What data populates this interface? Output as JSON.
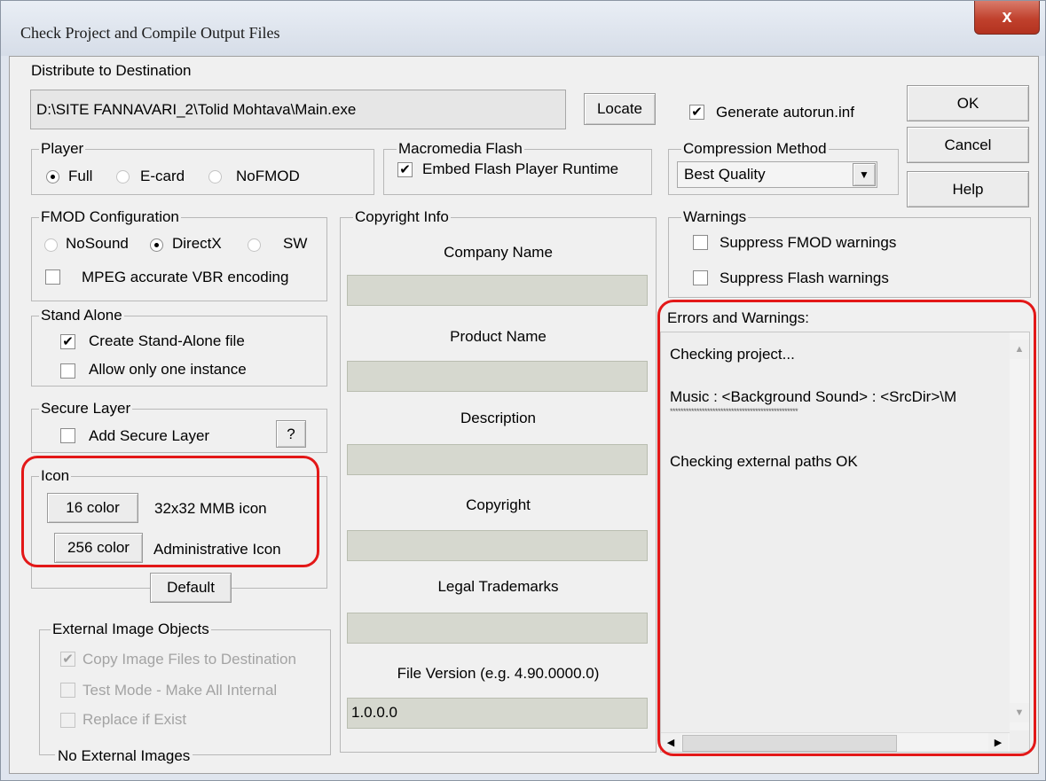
{
  "window": {
    "title": "Check Project and Compile Output Files",
    "close_label": "x"
  },
  "destination": {
    "label": "Distribute to Destination",
    "path": "D:\\SITE FANNAVARI_2\\Tolid Mohtava\\Main.exe",
    "locate_label": "Locate",
    "autorun_label": "Generate autorun.inf",
    "autorun_checked": true
  },
  "actions": {
    "ok": "OK",
    "cancel": "Cancel",
    "help": "Help"
  },
  "player": {
    "title": "Player",
    "options": [
      "Full",
      "E-card",
      "NoFMOD"
    ],
    "selected": "Full"
  },
  "flash": {
    "title": "Macromedia Flash",
    "embed_label": "Embed Flash Player Runtime",
    "embed_checked": true
  },
  "compression": {
    "title": "Compression Method",
    "selected": "Best Quality"
  },
  "fmod": {
    "title": "FMOD Configuration",
    "options": [
      "NoSound",
      "DirectX",
      "SW"
    ],
    "selected": "DirectX",
    "mpeg_label": "MPEG accurate VBR encoding",
    "mpeg_checked": false
  },
  "copyright": {
    "title": "Copyright Info",
    "company_label": "Company Name",
    "company_value": "",
    "product_label": "Product Name",
    "product_value": "",
    "description_label": "Description",
    "description_value": "",
    "copyright_label": "Copyright",
    "copyright_value": "",
    "trademarks_label": "Legal Trademarks",
    "trademarks_value": "",
    "version_label": "File Version (e.g. 4.90.0000.0)",
    "version_value": "1.0.0.0"
  },
  "warnings": {
    "title": "Warnings",
    "suppress_fmod": "Suppress FMOD warnings",
    "suppress_flash": "Suppress Flash warnings"
  },
  "standalone": {
    "title": "Stand Alone",
    "create_label": "Create Stand-Alone file",
    "create_checked": true,
    "one_instance_label": "Allow only one instance"
  },
  "secure": {
    "title": "Secure Layer",
    "add_label": "Add Secure Layer",
    "help_label": "?"
  },
  "icon": {
    "title": "Icon",
    "btn16": "16 color",
    "desc16": "32x32 MMB icon",
    "btn256": "256 color",
    "desc256": "Administrative Icon",
    "default_label": "Default"
  },
  "external": {
    "title": "External Image Objects",
    "copy_label": "Copy Image Files to Destination",
    "test_label": "Test Mode - Make All Internal",
    "replace_label": "Replace if Exist",
    "status": "No External Images"
  },
  "errors": {
    "title": "Errors and Warnings:",
    "lines": [
      "Checking project...",
      "Music : <Background Sound> : <SrcDir>\\M",
      "************************************************",
      "Checking external paths OK"
    ]
  },
  "colors": {
    "highlight": "#e31818",
    "field_bg": "#d6d8cf"
  },
  "icons": {
    "check": "checkmark-icon",
    "dropdown": "chevron-down-icon",
    "close": "close-icon"
  }
}
